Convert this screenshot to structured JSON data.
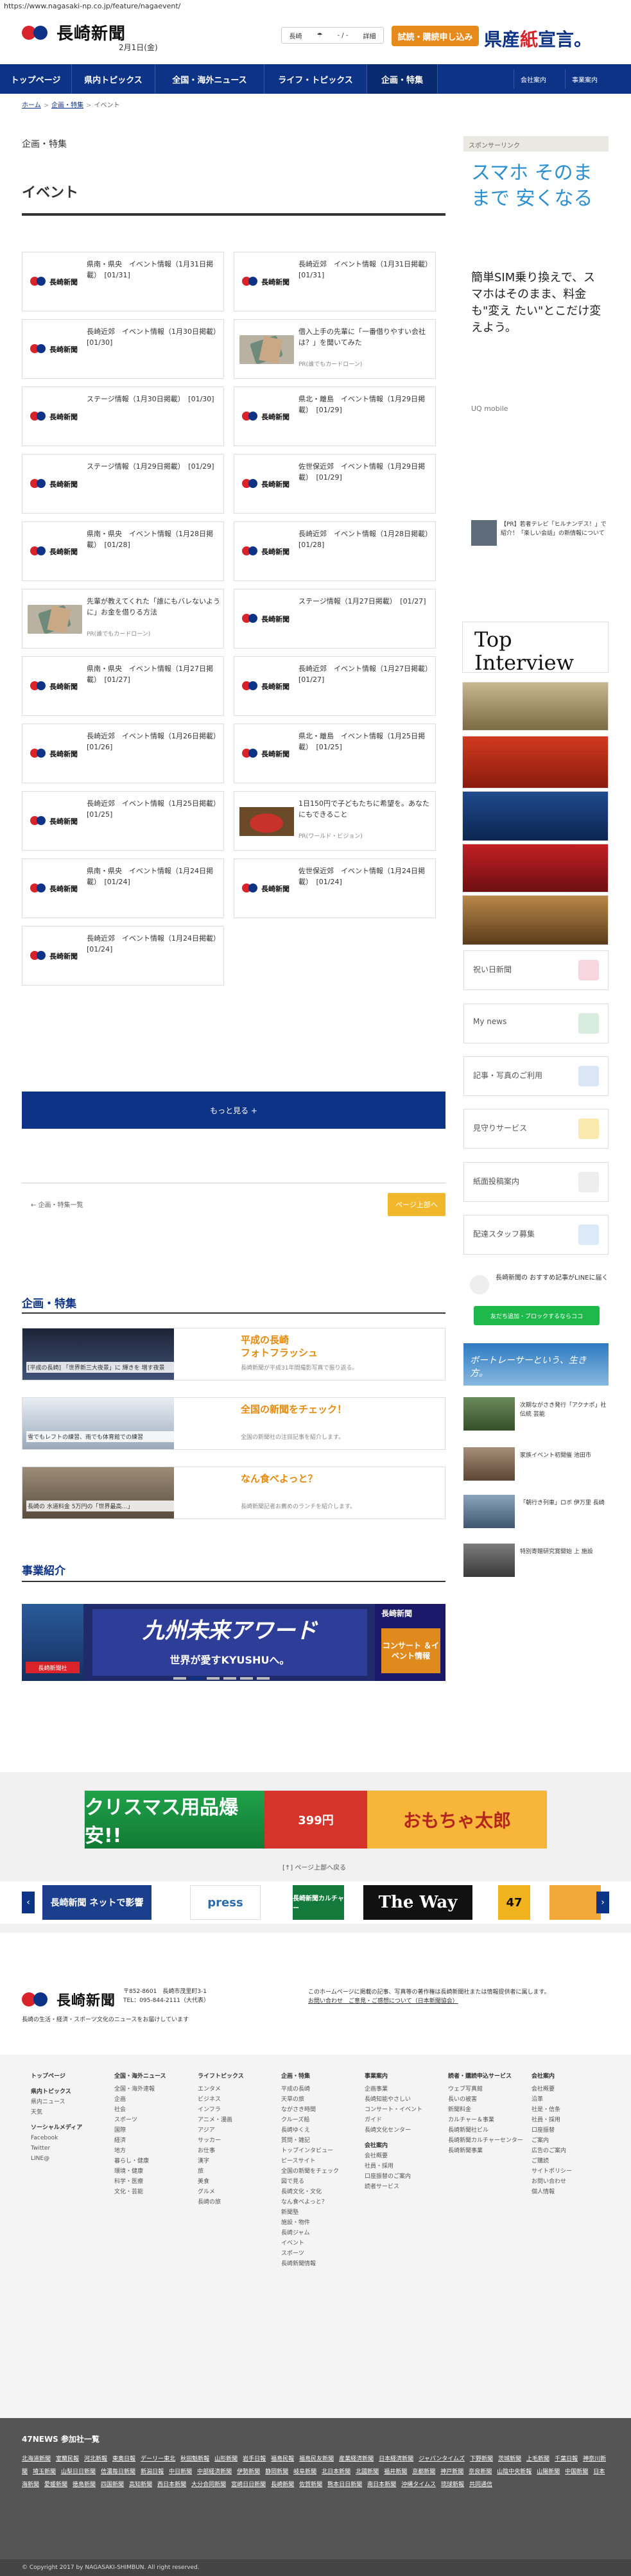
{
  "browser": {
    "url": "https://www.nagasaki-np.co.jp/feature/nagaevent/"
  },
  "header": {
    "logo_text": "長崎新聞",
    "date": "2月1日(金)",
    "weather_label": "長崎",
    "weather_value": "- / -",
    "weather_more": "詳細",
    "trial_button": "試読・購読申し込み",
    "slogan_a": "県産",
    "slogan_b": "紙",
    "slogan_c": "宣言。"
  },
  "nav": {
    "items": [
      "トップページ",
      "県内トピックス",
      "全国・海外ニュース",
      "ライフ・トピックス",
      "企画・特集"
    ],
    "right": [
      "会社案内",
      "事業案内"
    ]
  },
  "breadcrumb": [
    "ホーム",
    "企画・特集",
    "イベント"
  ],
  "page": {
    "category": "企画・特集",
    "title": "イベント"
  },
  "cards": [
    {
      "title": "県南・県央　イベント情報（1月31日掲載）　[01/31]",
      "sub": "",
      "thumb": "logo"
    },
    {
      "title": "長崎近郊　イベント情報（1月31日掲載）　[01/31]",
      "sub": "",
      "thumb": "logo"
    },
    {
      "title": "長崎近郊　イベント情報（1月30日掲載）　[01/30]",
      "sub": "",
      "thumb": "logo"
    },
    {
      "title": "借入上手の先輩に「一番借りやすい会社は？」を聞いてみた",
      "sub": "PR(誰でもカードローン)",
      "thumb": "money"
    },
    {
      "title": "ステージ情報（1月30日掲載）　[01/30]",
      "sub": "",
      "thumb": "logo"
    },
    {
      "title": "県北・離島　イベント情報（1月29日掲載）　[01/29]",
      "sub": "",
      "thumb": "logo"
    },
    {
      "title": "ステージ情報（1月29日掲載）　[01/29]",
      "sub": "",
      "thumb": "logo"
    },
    {
      "title": "佐世保近郊　イベント情報（1月29日掲載）　[01/29]",
      "sub": "",
      "thumb": "logo"
    },
    {
      "title": "県南・県央　イベント情報（1月28日掲載）　[01/28]",
      "sub": "",
      "thumb": "logo"
    },
    {
      "title": "長崎近郊　イベント情報（1月28日掲載）　[01/28]",
      "sub": "",
      "thumb": "logo"
    },
    {
      "title": "先輩が教えてくれた「誰にもバレないように」お金を借りる方法",
      "sub": "PR(誰でもカードローン)",
      "thumb": "money"
    },
    {
      "title": "ステージ情報（1月27日掲載）　[01/27]",
      "sub": "",
      "thumb": "logo"
    },
    {
      "title": "県南・県央　イベント情報（1月27日掲載）　[01/27]",
      "sub": "",
      "thumb": "logo"
    },
    {
      "title": "長崎近郊　イベント情報（1月27日掲載）　[01/27]",
      "sub": "",
      "thumb": "logo"
    },
    {
      "title": "長崎近郊　イベント情報（1月26日掲載）　[01/26]",
      "sub": "",
      "thumb": "logo"
    },
    {
      "title": "県北・離島　イベント情報（1月25日掲載）　[01/25]",
      "sub": "",
      "thumb": "logo"
    },
    {
      "title": "長崎近郊　イベント情報（1月25日掲載）　[01/25]",
      "sub": "",
      "thumb": "logo"
    },
    {
      "title": "1日150円で子どもたちに希望を。あなたにもできること",
      "sub": "PR(ワールド・ビジョン)",
      "thumb": "ramen"
    },
    {
      "title": "県南・県央　イベント情報（1月24日掲載）　[01/24]",
      "sub": "",
      "thumb": "logo"
    },
    {
      "title": "佐世保近郊　イベント情報（1月24日掲載）　[01/24]",
      "sub": "",
      "thumb": "logo"
    },
    {
      "title": "長崎近郊　イベント情報（1月24日掲載）　[01/24]",
      "sub": "",
      "thumb": "logo"
    }
  ],
  "more_button": "もっと見る +",
  "prev_category": "← 企画・特集一覧",
  "pagetop": "ページ上部へ",
  "feature_section": {
    "title": "企画・特集",
    "items": [
      {
        "caption": "[平成の長崎] 「世界新三大夜景」に 輝きを 増す夜景",
        "title1": "平成の長崎",
        "title2": "フォトフラッシュ",
        "desc": "長崎新聞が平成31年間撮影写真で振り返る。"
      },
      {
        "caption": "雪でもレフトの練習、雨でも体育館での練習",
        "title1": "全国の新聞をチェック！",
        "title2": "",
        "desc": "全国の新聞社の注目記事を紹介します。"
      },
      {
        "caption": "長崎の 水道料金 5万円の「世界最高…」",
        "title1": "なん食べよっと？",
        "title2": "",
        "desc": "長崎新聞記者お薦めのランチを紹介します。"
      }
    ]
  },
  "business": {
    "title": "事業紹介",
    "banner_title": "九州未来アワード",
    "banner_sub": "世界が愛すKYUSHUへ。",
    "banner_tag": "長崎新聞",
    "banner_right": "コンサート ＆イベント情報",
    "banner_left": "長崎新聞社"
  },
  "ads": {
    "a1": "クリスマス用品爆安!!",
    "a2": "399円",
    "a3": "おもちゃ太郎"
  },
  "gray_pagetop": "[↑] ページ上部へ戻る",
  "logos": [
    "長崎新聞 ネットで影響",
    "press",
    "長崎新聞カルチャー",
    "The Way",
    "47"
  ],
  "footer": {
    "logo_text": "長崎新聞",
    "postal": "〒852-8601　長崎市茂里町3-1",
    "tel": "TEL：095-844-2111（大代表）",
    "note": "このホームページに掲載の記事、写真等の著作権は長崎新聞社または情報提供者に属します。",
    "note2": "お問い合わせ　ご意見・ご感想について（日本新聞協会）",
    "desc": "長崎の生活・経済・スポーツ文化のニュースをお届けしています"
  },
  "sitemap": [
    {
      "head": "トップページ",
      "items": [],
      "subs": [
        {
          "sh": "県内トピックス",
          "items": [
            "県内ニュース",
            "天気"
          ]
        },
        {
          "sh": "ソーシャルメディア",
          "items": [
            "Facebook",
            "Twitter",
            "LINE@"
          ]
        }
      ]
    },
    {
      "head": "全国・海外ニュース",
      "items": [
        "全国・海外速報",
        "企画",
        "社会",
        "スポーツ",
        "国際",
        "経済",
        "地方",
        "暮らし・健康",
        "環境・健康",
        "科学・医療",
        "文化・芸能"
      ],
      "subs": []
    },
    {
      "head": "ライフトピックス",
      "items": [
        "エンタメ",
        "ビジネス",
        "インフラ",
        "アニメ・漫画",
        "アジア",
        "サッカー",
        "お仕事",
        "漢字",
        "旅",
        "美食",
        "グルメ",
        "長崎の旅"
      ],
      "subs": []
    },
    {
      "head": "企画・特集",
      "items": [
        "平成の長崎",
        "天草の旅",
        "ながさき時間",
        "クルーズ船",
        "長崎ゆくえ",
        "質問・雑記",
        "トップインタビュー",
        "ピースサイト",
        "全国の新聞をチェック",
        "図で見る",
        "長崎文化・文化",
        "なん食べよっと？",
        "新聞塾",
        "施設・物件",
        "長崎ジャム",
        "イベント",
        "スポーツ",
        "長崎新聞情報"
      ],
      "subs": []
    },
    {
      "head": "事業案内",
      "items": [
        "企画事業",
        "長崎知能やさしい",
        "コンサート・イベント",
        "ガイド",
        "長崎文化センター"
      ],
      "subs": [
        {
          "sh": "会社案内",
          "items": [
            "会社概要",
            "社員・採用",
            "口座振替のご案内",
            "読者サービス"
          ]
        }
      ]
    },
    {
      "head": "読者・購読申込サービス",
      "items": [
        "ウェブ写真館",
        "長いの被害",
        "新聞料金",
        "カルチャー＆事業",
        "長崎新聞社ビル",
        "長崎新聞カルチャーセンター",
        "長崎新聞事業"
      ],
      "subs": []
    },
    {
      "head": "会社案内",
      "items": [
        "会社概要",
        "沿革",
        "社是・信条",
        "社員・採用",
        "口座振替",
        "ご案内",
        "広告のご案内",
        "ご購読",
        "サイトポリシー",
        "お問い合わせ",
        "個人情報"
      ],
      "subs": []
    }
  ],
  "n47": {
    "title": "47NEWS 参加社一覧",
    "papers": [
      "北海道新聞",
      "室蘭民報",
      "河北新報",
      "東奥日報",
      "デーリー東北",
      "秋田魁新報",
      "山形新聞",
      "岩手日報",
      "福島民報",
      "福島民友新聞",
      "産業経済新聞",
      "日本経済新聞",
      "ジャパンタイムズ",
      "下野新聞",
      "茨城新聞",
      "上毛新聞",
      "千葉日報",
      "神奈川新聞",
      "埼玉新聞",
      "山梨日日新聞",
      "信濃毎日新聞",
      "新潟日報",
      "中日新聞",
      "中部経済新聞",
      "伊勢新聞",
      "静岡新聞",
      "岐阜新聞",
      "北日本新聞",
      "北國新聞",
      "福井新聞",
      "京都新聞",
      "神戸新聞",
      "奈良新聞",
      "山陰中央新報",
      "山陽新聞",
      "中国新聞",
      "日本海新聞",
      "愛媛新聞",
      "徳島新聞",
      "四国新聞",
      "高知新聞",
      "西日本新聞",
      "大分合同新聞",
      "宮崎日日新聞",
      "長崎新聞",
      "佐賀新聞",
      "熊本日日新聞",
      "南日本新聞",
      "沖縄タイムス",
      "琉球新報",
      "共同通信"
    ]
  },
  "copyright": "© Copyright 2017 by NAGASAKI-SHIMBUN. All right reserved.",
  "sidebar": {
    "sponsor": "スポンサーリンク",
    "ad_l1": "スマホ そのままで 安くなる",
    "ad_l2": "簡単SIM乗り換えで、スマホはそのまま、料金も\"変え たい\"とこだけ変えよう。",
    "ad_l3": "UQ mobile",
    "pr": "【PR】若者テレビ「ヒルナンデス！」で紹介！「楽しい会話」の新情報について",
    "services": [
      "祝い日新聞",
      "My news",
      "記事・写真のご利用",
      "見守りサービス",
      "紙面投稿案内",
      "配達スタッフ募集"
    ],
    "line_text": "長崎新聞の おすすめ記事がLINEに届く",
    "line_btn": "友だち追加・ブロックするならココ",
    "sea_text": "ボートレーサーという、生き方。",
    "news": [
      "次期ながさき発行「アクナポ」社 伝統 芸能",
      "家族イベント初開催 池田市",
      "「朝行き列車」ロボ 伊万里 長崎",
      "特別寄贈研究賞開始 上 施設"
    ]
  }
}
